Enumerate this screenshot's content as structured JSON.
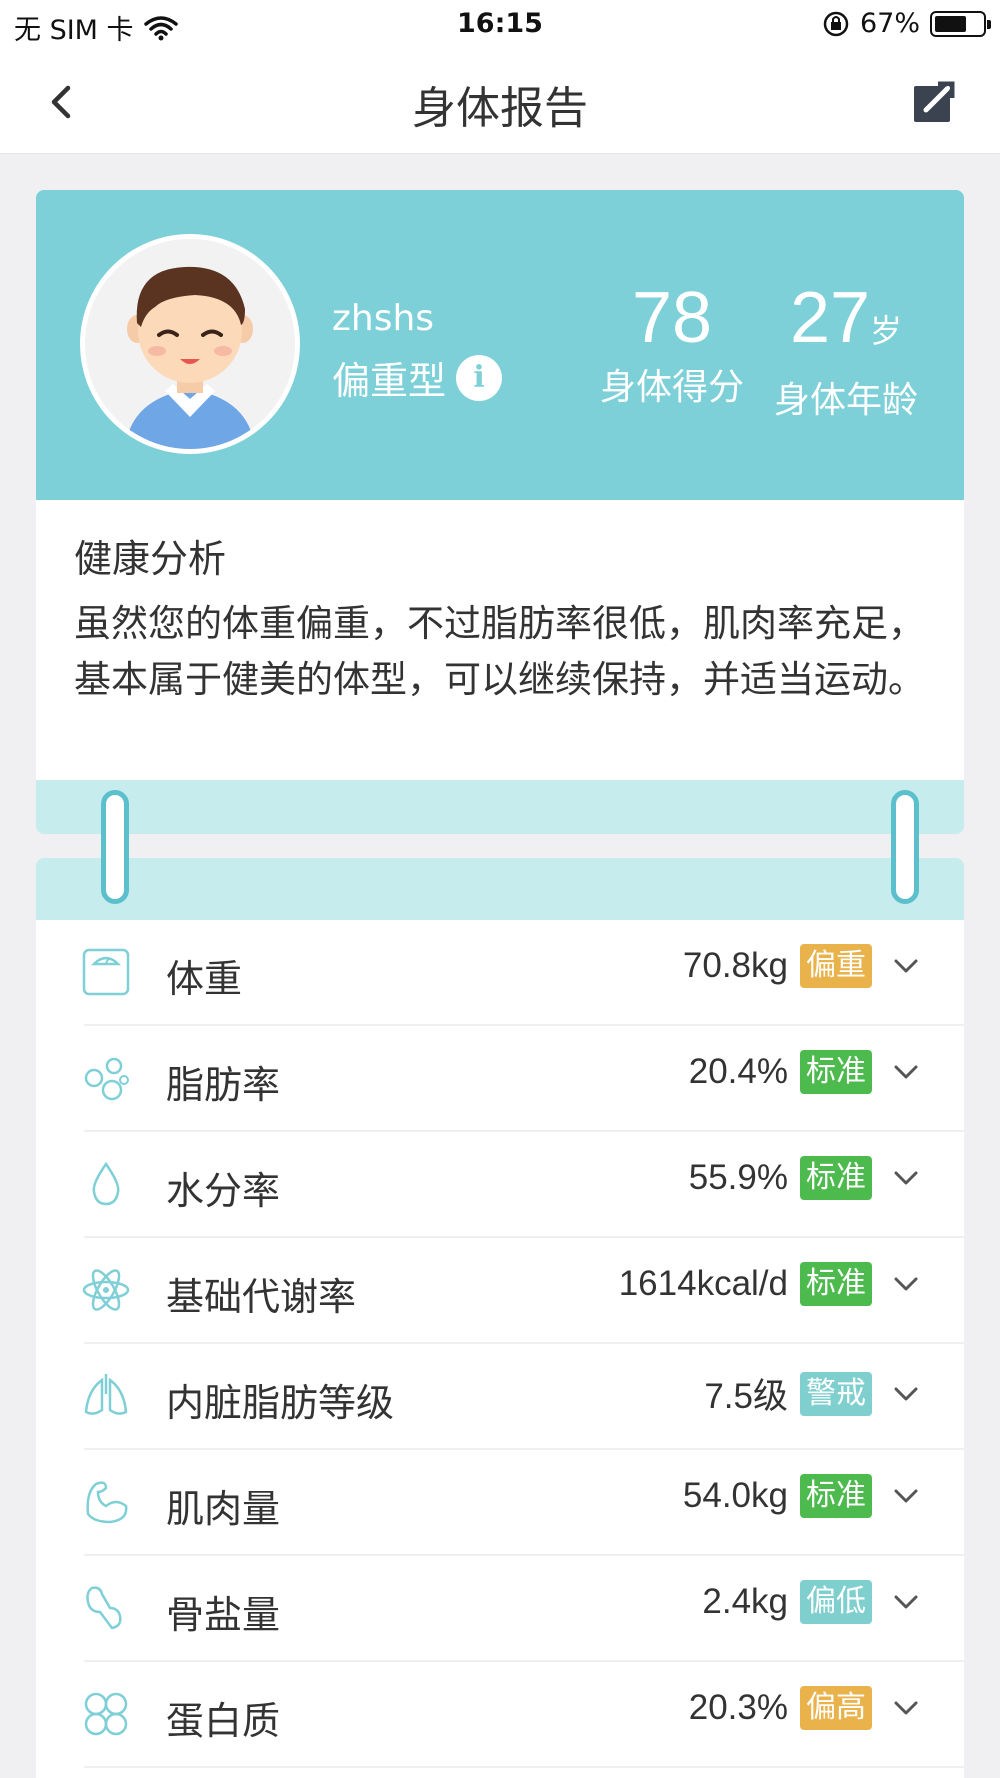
{
  "status_bar": {
    "carrier": "无 SIM 卡",
    "time": "16:15",
    "battery_percent": "67%",
    "battery_level": 0.67
  },
  "nav": {
    "title": "身体报告"
  },
  "profile": {
    "name": "zhshs",
    "body_type": "偏重型",
    "info_icon_glyph": "i",
    "score_value": "78",
    "score_label": "身体得分",
    "age_value": "27",
    "age_unit": "岁",
    "age_label": "身体年龄"
  },
  "analysis": {
    "title": "健康分析",
    "text": "虽然您的体重偏重，不过脂肪率很低，肌肉率充足，基本属于健美的体型，可以继续保持，并适当运动。"
  },
  "metrics": [
    {
      "icon": "scale-icon",
      "label": "体重",
      "value": "70.8kg",
      "badge": "偏重",
      "badge_color": "#e9b24a"
    },
    {
      "icon": "fat-cells-icon",
      "label": "脂肪率",
      "value": "20.4%",
      "badge": "标准",
      "badge_color": "#4cba4c"
    },
    {
      "icon": "water-drop-icon",
      "label": "水分率",
      "value": "55.9%",
      "badge": "标准",
      "badge_color": "#4cba4c"
    },
    {
      "icon": "atom-icon",
      "label": "基础代谢率",
      "value": "1614kcal/d",
      "badge": "标准",
      "badge_color": "#4cba4c"
    },
    {
      "icon": "lungs-icon",
      "label": "内脏脂肪等级",
      "value": "7.5级",
      "badge": "警戒",
      "badge_color": "#7fcfcf"
    },
    {
      "icon": "muscle-arm-icon",
      "label": "肌肉量",
      "value": "54.0kg",
      "badge": "标准",
      "badge_color": "#4cba4c"
    },
    {
      "icon": "bone-icon",
      "label": "骨盐量",
      "value": "2.4kg",
      "badge": "偏低",
      "badge_color": "#7fcfcf"
    },
    {
      "icon": "protein-icon",
      "label": "蛋白质",
      "value": "20.3%",
      "badge": "偏高",
      "badge_color": "#e9b24a"
    }
  ],
  "colors": {
    "accent": "#7dd0d8",
    "binder": "#c7ecee",
    "ring": "#5bc0cc",
    "icon_stroke": "#7fcfd6"
  }
}
